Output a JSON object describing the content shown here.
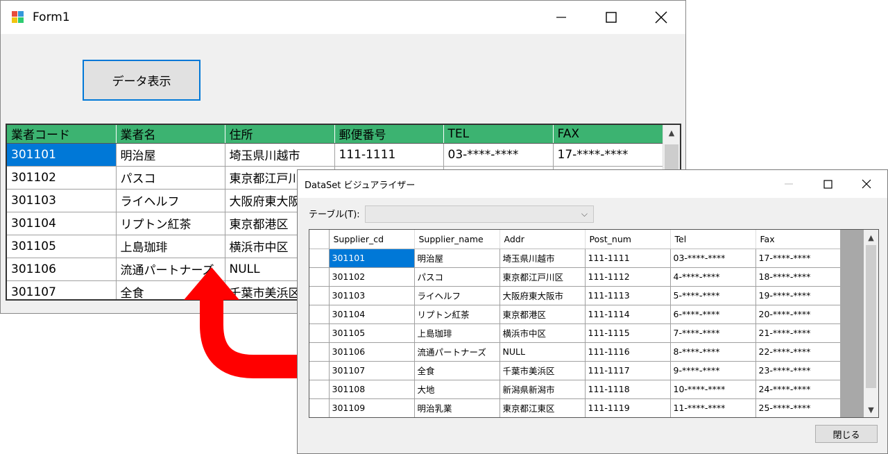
{
  "form1": {
    "title": "Form1",
    "data_button_label": "データ表示",
    "grid": {
      "columns": [
        "業者コード",
        "業者名",
        "住所",
        "郵便番号",
        "TEL",
        "FAX"
      ],
      "rows": [
        [
          "301101",
          "明治屋",
          "埼玉県川越市",
          "111-1111",
          "03-****-****",
          "17-****-****"
        ],
        [
          "301102",
          "パスコ",
          "東京都江戸川区",
          "",
          "",
          ""
        ],
        [
          "301103",
          "ライヘルフ",
          "大阪府東大阪",
          "",
          "",
          ""
        ],
        [
          "301104",
          "リプトン紅茶",
          "東京都港区",
          "",
          "",
          ""
        ],
        [
          "301105",
          "上島珈琲",
          "横浜市中区",
          "",
          "",
          ""
        ],
        [
          "301106",
          "流通パートナーズ",
          "NULL",
          "",
          "",
          ""
        ],
        [
          "301107",
          "全食",
          "千葉市美浜区",
          "",
          "",
          ""
        ]
      ]
    }
  },
  "visualizer": {
    "title": "DataSet ビジュアライザー",
    "table_label": "テーブル(T):",
    "table_select_value": "",
    "close_label": "閉じる",
    "grid": {
      "columns": [
        "Supplier_cd",
        "Supplier_name",
        "Addr",
        "Post_num",
        "Tel",
        "Fax"
      ],
      "rows": [
        [
          "301101",
          "明治屋",
          "埼玉県川越市",
          "111-1111",
          "03-****-****",
          "17-****-****"
        ],
        [
          "301102",
          "パスコ",
          "東京都江戸川区",
          "111-1112",
          "4-****-****",
          "18-****-****"
        ],
        [
          "301103",
          "ライヘルフ",
          "大阪府東大阪市",
          "111-1113",
          "5-****-****",
          "19-****-****"
        ],
        [
          "301104",
          "リプトン紅茶",
          "東京都港区",
          "111-1114",
          "6-****-****",
          "20-****-****"
        ],
        [
          "301105",
          "上島珈琲",
          "横浜市中区",
          "111-1115",
          "7-****-****",
          "21-****-****"
        ],
        [
          "301106",
          "流通パートナーズ",
          "NULL",
          "111-1116",
          "8-****-****",
          "22-****-****"
        ],
        [
          "301107",
          "全食",
          "千葉市美浜区",
          "111-1117",
          "9-****-****",
          "23-****-****"
        ],
        [
          "301108",
          "大地",
          "新潟県新潟市",
          "111-1118",
          "10-****-****",
          "24-****-****"
        ],
        [
          "301109",
          "明治乳業",
          "東京都江東区",
          "111-1119",
          "11-****-****",
          "25-****-****"
        ]
      ]
    }
  },
  "colors": {
    "header_green": "#3cb371",
    "selection_blue": "#0078d7",
    "arrow_red": "#ff0000"
  },
  "icons": {
    "form_icon": "winforms-app-icon",
    "minimize": "minimize-icon",
    "maximize": "maximize-icon",
    "close": "close-icon",
    "pointer": "red-curved-arrow-icon"
  }
}
